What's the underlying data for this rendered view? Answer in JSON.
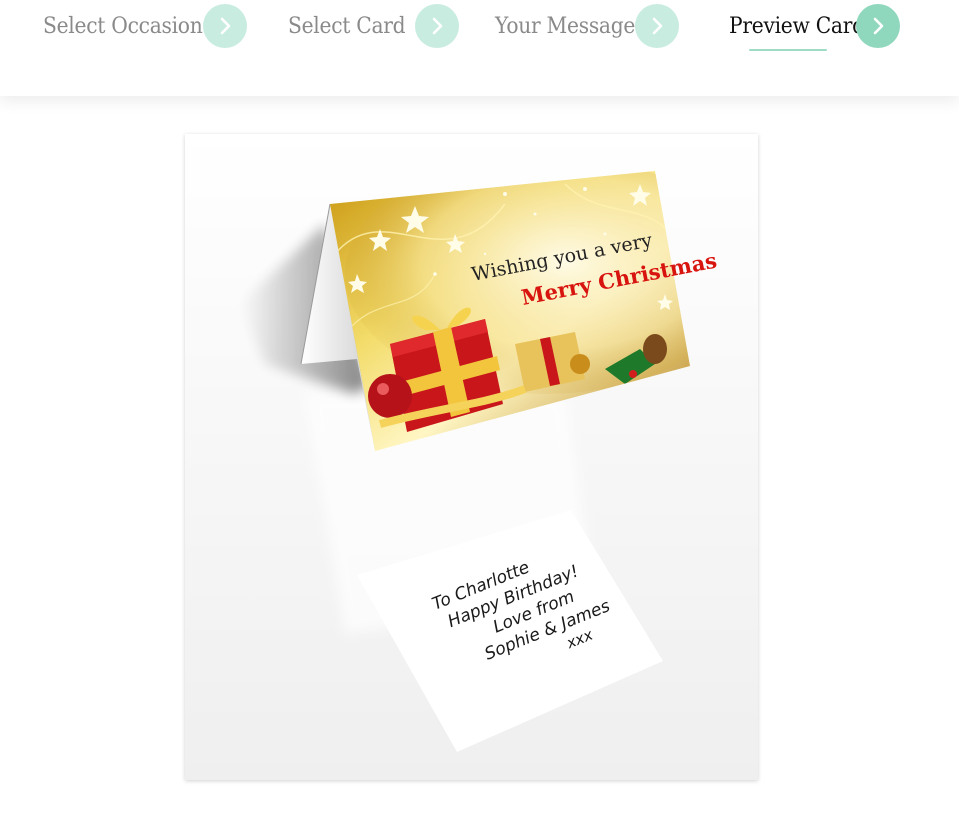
{
  "steps": [
    {
      "label": "Select Occasion",
      "active": false
    },
    {
      "label": "Select Card",
      "active": false
    },
    {
      "label": "Your Message",
      "active": false
    },
    {
      "label": "Preview Card",
      "active": true
    }
  ],
  "card": {
    "front_line1": "Wishing you a very",
    "front_line2": "Merry Christmas"
  },
  "message": {
    "line1": "To Charlotte",
    "line2": "Happy Birthday!",
    "line3": "Love from",
    "line4": "Sophie & James",
    "line5": "xxx"
  },
  "colors": {
    "accent": "#90d8bd",
    "accent_light": "#c9ece0",
    "greeting_red": "#d8140f"
  }
}
